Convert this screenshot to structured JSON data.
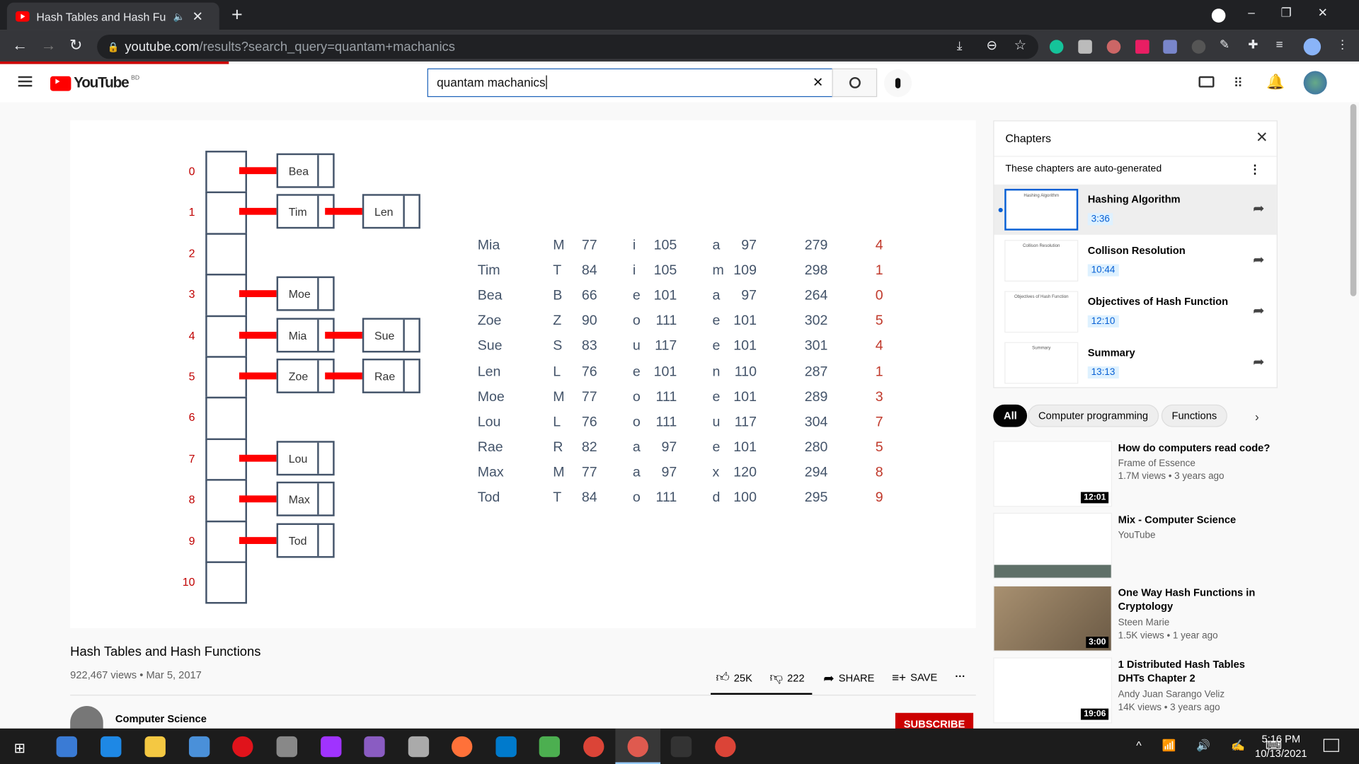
{
  "browser": {
    "tab_title": "Hash Tables and Hash Functions",
    "url_host": "youtube.com",
    "url_path": "/results?search_query=quantam+machanics"
  },
  "youtube": {
    "logo": "YouTube",
    "region": "BD",
    "search_value": "quantam machanics"
  },
  "diagram": {
    "slots": [
      "0",
      "1",
      "2",
      "3",
      "4",
      "5",
      "6",
      "7",
      "8",
      "9",
      "10"
    ],
    "chains": [
      [
        "Bea"
      ],
      [
        "Tim",
        "Len"
      ],
      [],
      [
        "Moe"
      ],
      [
        "Mia",
        "Sue"
      ],
      [
        "Zoe",
        "Rae"
      ],
      [],
      [
        "Lou"
      ],
      [
        "Max"
      ],
      [
        "Tod"
      ],
      []
    ]
  },
  "table": [
    [
      "Mia",
      "M",
      "77",
      "i",
      "105",
      "a",
      "97",
      "279",
      "4"
    ],
    [
      "Tim",
      "T",
      "84",
      "i",
      "105",
      "m",
      "109",
      "298",
      "1"
    ],
    [
      "Bea",
      "B",
      "66",
      "e",
      "101",
      "a",
      "97",
      "264",
      "0"
    ],
    [
      "Zoe",
      "Z",
      "90",
      "o",
      "111",
      "e",
      "101",
      "302",
      "5"
    ],
    [
      "Sue",
      "S",
      "83",
      "u",
      "117",
      "e",
      "101",
      "301",
      "4"
    ],
    [
      "Len",
      "L",
      "76",
      "e",
      "101",
      "n",
      "110",
      "287",
      "1"
    ],
    [
      "Moe",
      "M",
      "77",
      "o",
      "111",
      "e",
      "101",
      "289",
      "3"
    ],
    [
      "Lou",
      "L",
      "76",
      "o",
      "111",
      "u",
      "117",
      "304",
      "7"
    ],
    [
      "Rae",
      "R",
      "82",
      "a",
      "97",
      "e",
      "101",
      "280",
      "5"
    ],
    [
      "Max",
      "M",
      "77",
      "a",
      "97",
      "x",
      "120",
      "294",
      "8"
    ],
    [
      "Tod",
      "T",
      "84",
      "o",
      "111",
      "d",
      "100",
      "295",
      "9"
    ]
  ],
  "video": {
    "title": "Hash Tables and Hash Functions",
    "views": "922,467 views",
    "date": "Mar 5, 2017",
    "likes": "25K",
    "dislikes": "222",
    "share": "SHARE",
    "save": "SAVE",
    "channel": "Computer Science",
    "subscribe": "SUBSCRIBE"
  },
  "chapters": {
    "heading": "Chapters",
    "note": "These chapters are auto-generated",
    "items": [
      {
        "title": "Hashing Algorithm",
        "time": "3:36"
      },
      {
        "title": "Collison Resolution",
        "time": "10:44"
      },
      {
        "title": "Objectives of Hash Function",
        "time": "12:10"
      },
      {
        "title": "Summary",
        "time": "13:13"
      }
    ]
  },
  "chips": [
    "All",
    "Computer programming",
    "Functions"
  ],
  "related": [
    {
      "title": "How do computers read code?",
      "channel": "Frame of Essence",
      "meta": "1.7M views • 3 years ago",
      "duration": "12:01"
    },
    {
      "title": "Mix - Computer Science",
      "channel": "YouTube",
      "meta": "",
      "duration": ""
    },
    {
      "title": "One Way Hash Functions in Cryptology",
      "channel": "Steen Marie",
      "meta": "1.5K views • 1 year ago",
      "duration": "3:00"
    },
    {
      "title": "1 Distributed Hash Tables DHTs Chapter 2",
      "channel": "Andy Juan Sarango Veliz",
      "meta": "14K views • 3 years ago",
      "duration": "19:06"
    }
  ],
  "taskbar": {
    "time": "5:16 PM",
    "date": "10/13/2021"
  }
}
